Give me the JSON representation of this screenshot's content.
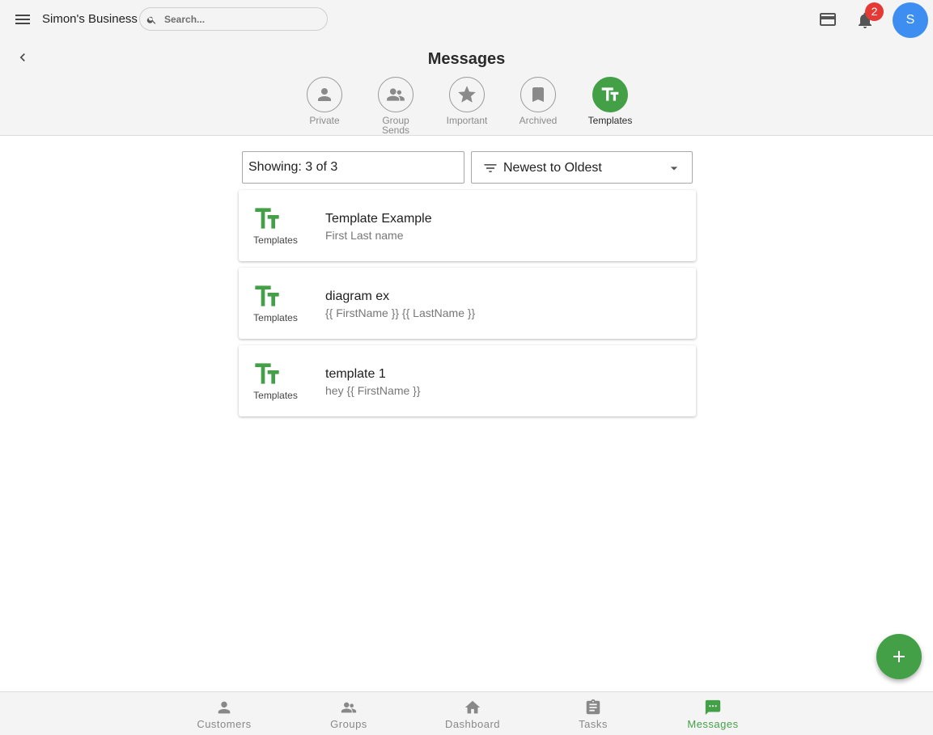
{
  "topbar": {
    "business_name": "Simon's Business",
    "search_placeholder": "Search...",
    "notification_count": "2",
    "avatar_initial": "S",
    "avatar_color": "#3d8ef0"
  },
  "header": {
    "title": "Messages",
    "categories": [
      {
        "label": "Private",
        "icon": "person-icon",
        "active": false
      },
      {
        "label": "Group Sends",
        "icon": "group-icon",
        "active": false
      },
      {
        "label": "Important",
        "icon": "star-icon",
        "active": false
      },
      {
        "label": "Archived",
        "icon": "bookmark-icon",
        "active": false
      },
      {
        "label": "Templates",
        "icon": "text-fields-icon",
        "active": true
      }
    ]
  },
  "controls": {
    "showing": "Showing: 3 of 3",
    "sort": "Newest to Oldest"
  },
  "messages": [
    {
      "type": "Templates",
      "title": "Template Example",
      "subtitle": "First Last name"
    },
    {
      "type": "Templates",
      "title": "diagram ex",
      "subtitle": "{{ FirstName }} {{ LastName }}"
    },
    {
      "type": "Templates",
      "title": "template 1",
      "subtitle": "hey {{ FirstName }}"
    }
  ],
  "bottom_nav": [
    {
      "label": "Customers",
      "icon": "person-icon",
      "active": false
    },
    {
      "label": "Groups",
      "icon": "group-icon",
      "active": false
    },
    {
      "label": "Dashboard",
      "icon": "home-icon",
      "active": false
    },
    {
      "label": "Tasks",
      "icon": "clipboard-icon",
      "active": false
    },
    {
      "label": "Messages",
      "icon": "chat-icon",
      "active": true
    }
  ],
  "colors": {
    "accent": "#43a047",
    "badge": "#e53935",
    "background": "#f4f4f4"
  }
}
